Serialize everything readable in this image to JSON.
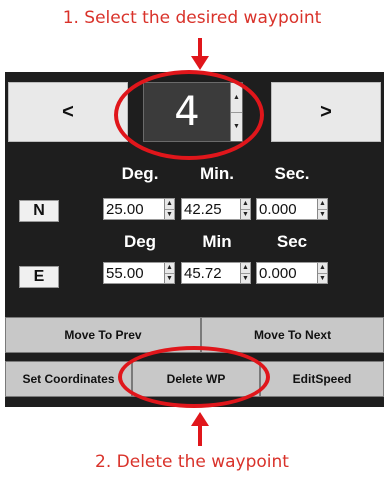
{
  "captions": {
    "top": "1. Select the desired waypoint",
    "bottom": "2. Delete the waypoint"
  },
  "nav": {
    "prev_label": "<",
    "next_label": ">",
    "waypoint_value": "4"
  },
  "spin": {
    "up": "▲",
    "down": "▼"
  },
  "latitude": {
    "headers": [
      "Deg.",
      "Min.",
      "Sec."
    ],
    "direction": "N",
    "deg": "25.00",
    "min": "42.25",
    "sec": "0.000"
  },
  "longitude": {
    "headers": [
      "Deg",
      "Min",
      "Sec"
    ],
    "direction": "E",
    "deg": "55.00",
    "min": "45.72",
    "sec": "0.000"
  },
  "buttons": {
    "move_prev": "Move To Prev",
    "move_next": "Move To Next",
    "set_coordinates": "Set Coordinates",
    "delete_wp": "Delete WP",
    "edit_speed": "EditSpeed"
  },
  "colors": {
    "annotation": "#e0161b",
    "caption_text": "#d9322a",
    "panel_bg": "#1e1e1e"
  }
}
